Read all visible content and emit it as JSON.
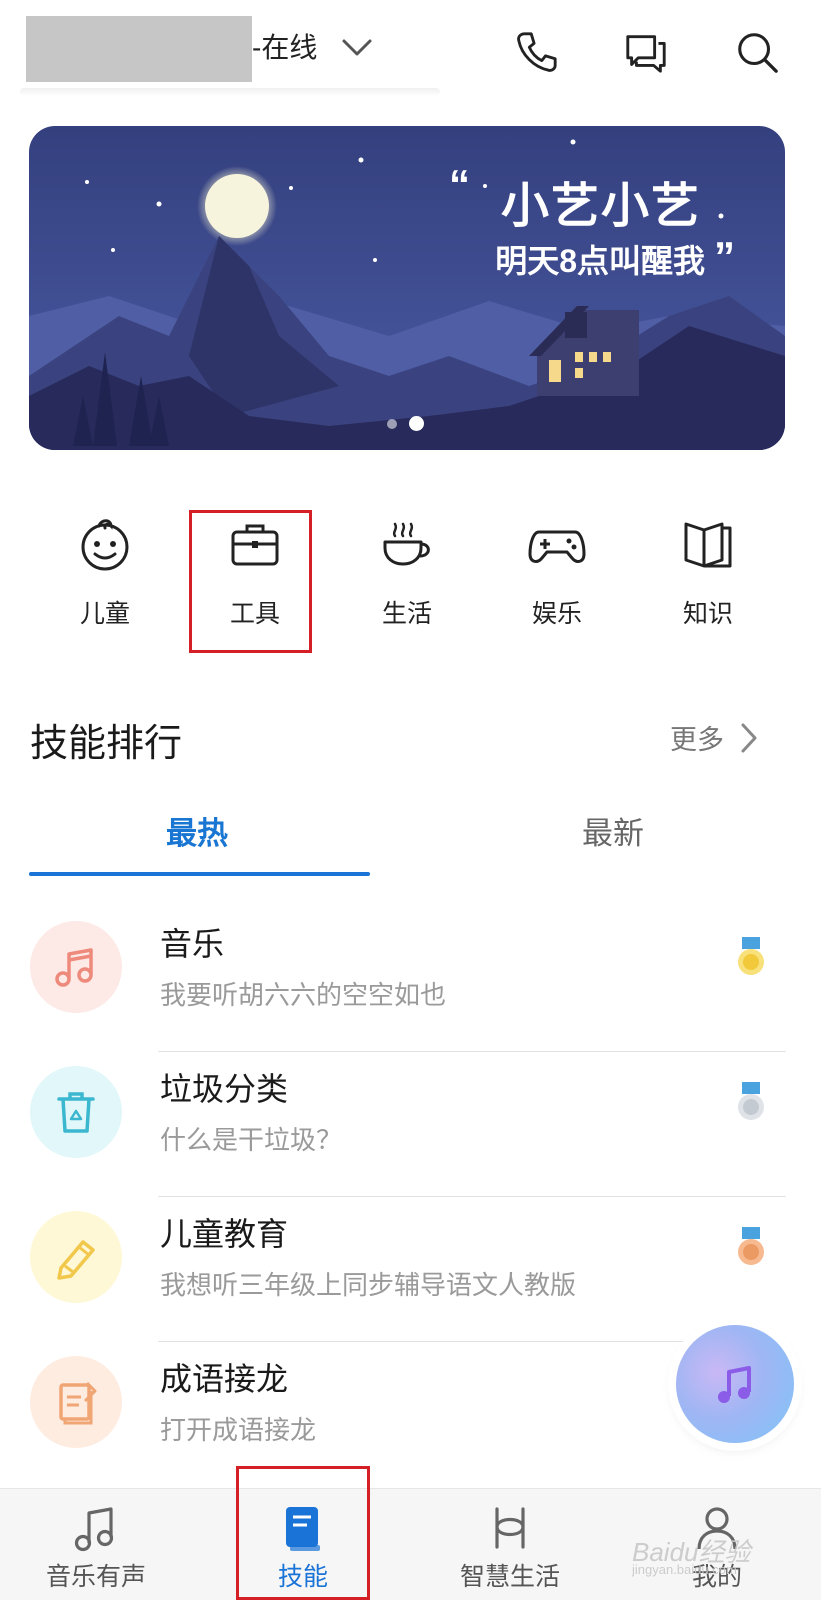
{
  "header": {
    "device_status": "-在线",
    "icons": {
      "status_dropdown": "chevron-down-icon",
      "phone": "phone-icon",
      "chat": "chat-icon",
      "search": "search-icon"
    }
  },
  "banner": {
    "line1": "小艺小艺",
    "line2": "明天8点叫醒我",
    "quote_open": "“",
    "quote_close": "”",
    "page_count": 2,
    "active_page": 2
  },
  "categories": [
    {
      "label": "儿童",
      "icon": "child-face-icon"
    },
    {
      "label": "工具",
      "icon": "toolbox-icon"
    },
    {
      "label": "生活",
      "icon": "coffee-cup-icon"
    },
    {
      "label": "娱乐",
      "icon": "gamepad-icon"
    },
    {
      "label": "知识",
      "icon": "book-open-icon"
    }
  ],
  "ranking": {
    "title": "技能排行",
    "more_label": "更多",
    "tabs": [
      {
        "label": "最热",
        "active": true
      },
      {
        "label": "最新",
        "active": false
      }
    ],
    "items": [
      {
        "title": "音乐",
        "subtitle": "我要听胡六六的空空如也",
        "icon": "music-note-icon",
        "medal": "gold-medal-icon"
      },
      {
        "title": "垃圾分类",
        "subtitle": "什么是干垃圾？",
        "icon": "recycle-bin-icon",
        "medal": "silver-medal-icon"
      },
      {
        "title": "儿童教育",
        "subtitle": "我想听三年级上同步辅导语文人教版",
        "icon": "pencil-icon",
        "medal": "bronze-medal-icon"
      },
      {
        "title": "成语接龙",
        "subtitle": "打开成语接龙",
        "icon": "idiom-book-icon",
        "medal": ""
      }
    ]
  },
  "bottom_nav": [
    {
      "label": "音乐有声",
      "icon": "music-note-icon",
      "active": false
    },
    {
      "label": "技能",
      "icon": "skill-book-icon",
      "active": true
    },
    {
      "label": "智慧生活",
      "icon": "smart-life-icon",
      "active": false
    },
    {
      "label": "我的",
      "icon": "person-icon",
      "active": false
    }
  ],
  "watermark": {
    "text": "Baidu经验",
    "sub": "jingyan.baidu.com"
  },
  "colors": {
    "accent": "#1a73d6",
    "highlight_box": "#d41f26",
    "banner_bg": "#3c4a8c"
  }
}
